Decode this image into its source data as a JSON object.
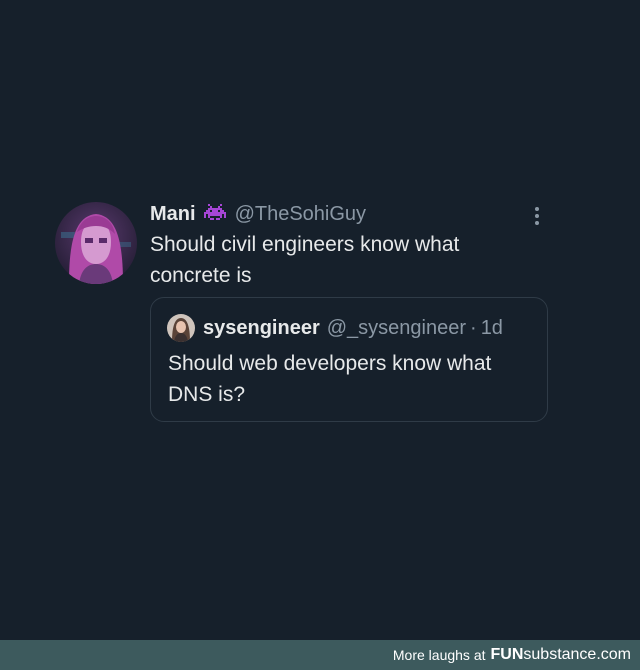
{
  "tweet": {
    "author_name": "Mani",
    "author_emoji": "alien-monster-icon",
    "author_handle": "@TheSohiGuy",
    "text": "Should civil engineers know what concrete is",
    "more_icon": "more-vertical-icon"
  },
  "quote": {
    "author_name": "sysengineer",
    "author_handle": "@_sysengineer",
    "separator": "·",
    "time": "1d",
    "text": "Should web developers know what DNS is?"
  },
  "footer": {
    "text": "More laughs at",
    "brand_bold": "FUN",
    "brand_rest": "substance.com"
  },
  "colors": {
    "background": "#16202b",
    "text_primary": "#e7e9ea",
    "text_secondary": "#8b98a5",
    "quote_border": "#2f3b47",
    "footer_bg": "#3d5a5d",
    "emoji": "#a646d6"
  }
}
